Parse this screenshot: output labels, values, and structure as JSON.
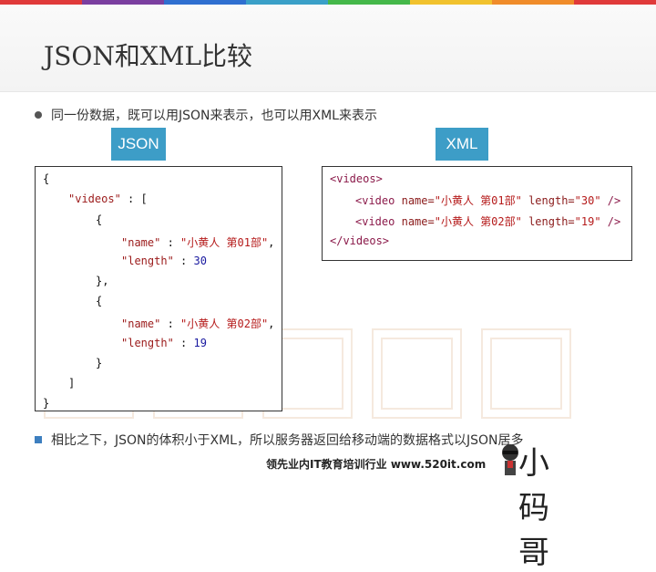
{
  "colors": {
    "badge": "#3d9dc7",
    "topbar": [
      "#e03a3a",
      "#7b3fa0",
      "#2f6fd0",
      "#3aa0c8",
      "#45b84a",
      "#f1c22e",
      "#f08c2a",
      "#e03a3a"
    ]
  },
  "slide": {
    "title": "JSON和XML比较",
    "bullet1": "同一份数据，既可以用JSON来表示，也可以用XML来表示",
    "badge_json": "JSON",
    "badge_xml": "XML",
    "bullet2": "相比之下，JSON的体积小于XML，所以服务器返回给移动端的数据格式以JSON居多",
    "footer": "领先业内IT教育培训行业 www.520it.com",
    "logo_text": "小码哥"
  },
  "json_code": {
    "l1": "{",
    "videos_key": "\"videos\"",
    "colon_bracket": " : [",
    "obj_open1": "{",
    "name_key1": "\"name\"",
    "name_val1": "\"小黄人 第01部\"",
    "length_key1": "\"length\"",
    "length_val1": "30",
    "obj_close1": "},",
    "obj_open2": "{",
    "name_key2": "\"name\"",
    "name_val2": "\"小黄人 第02部\"",
    "length_key2": "\"length\"",
    "length_val2": "19",
    "obj_close2": "}",
    "arr_close": "]",
    "l_end": "}"
  },
  "xml_code": {
    "open": "<videos>",
    "v1_tag": "<video",
    "v1_name_attr": "name=",
    "v1_name_val": "\"小黄人 第01部\"",
    "v1_len_attr": "length=",
    "v1_len_val": "\"30\"",
    "v1_close": "/>",
    "v2_tag": "<video",
    "v2_name_attr": "name=",
    "v2_name_val": "\"小黄人 第02部\"",
    "v2_len_attr": "length=",
    "v2_len_val": "\"19\"",
    "v2_close": "/>",
    "close": "</videos>"
  }
}
